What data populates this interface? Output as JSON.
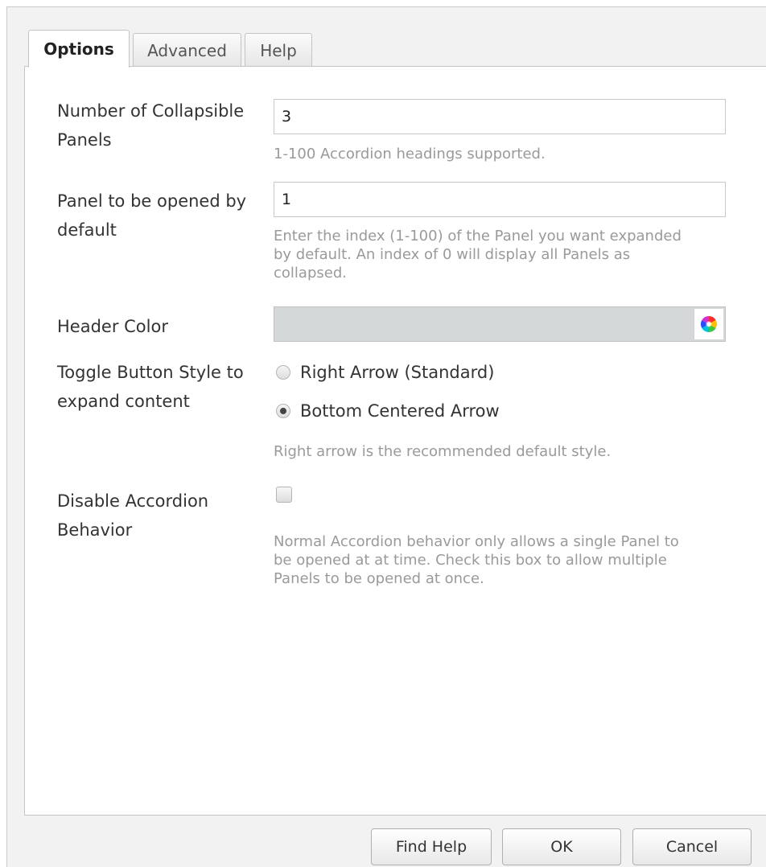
{
  "tabs": [
    {
      "label": "Options",
      "active": true
    },
    {
      "label": "Advanced",
      "active": false
    },
    {
      "label": "Help",
      "active": false
    }
  ],
  "fields": {
    "panels": {
      "label_line1": "Number of Collapsible",
      "label_line2": "Panels",
      "value": "3",
      "help": "1-100 Accordion headings supported."
    },
    "default_panel": {
      "label_line1": "Panel to be opened by",
      "label_line2": "default",
      "value": "1",
      "help_line1": "Enter the index (1-100) of the Panel you want expanded",
      "help_line2": "by default. An index of 0 will display all Panels as",
      "help_line3": "collapsed."
    },
    "header_color": {
      "label": "Header Color",
      "color": "#d5d8d9",
      "icon": "color-wheel-icon"
    },
    "toggle_style": {
      "label_line1": "Toggle Button Style to",
      "label_line2": "expand content",
      "options": [
        {
          "label": "Right Arrow (Standard)",
          "selected": false
        },
        {
          "label": "Bottom Centered Arrow",
          "selected": true
        }
      ],
      "help": "Right arrow is the recommended default style."
    },
    "disable_behavior": {
      "label_line1": "Disable Accordion",
      "label_line2": "Behavior",
      "checked": false,
      "help_line1": "Normal Accordion behavior only allows a single Panel to",
      "help_line2": "be opened at at time. Check this box to allow multiple",
      "help_line3": "Panels to be opened at once."
    }
  },
  "footer": {
    "find_help_label": "Find Help",
    "ok_label": "OK",
    "cancel_label": "Cancel"
  }
}
